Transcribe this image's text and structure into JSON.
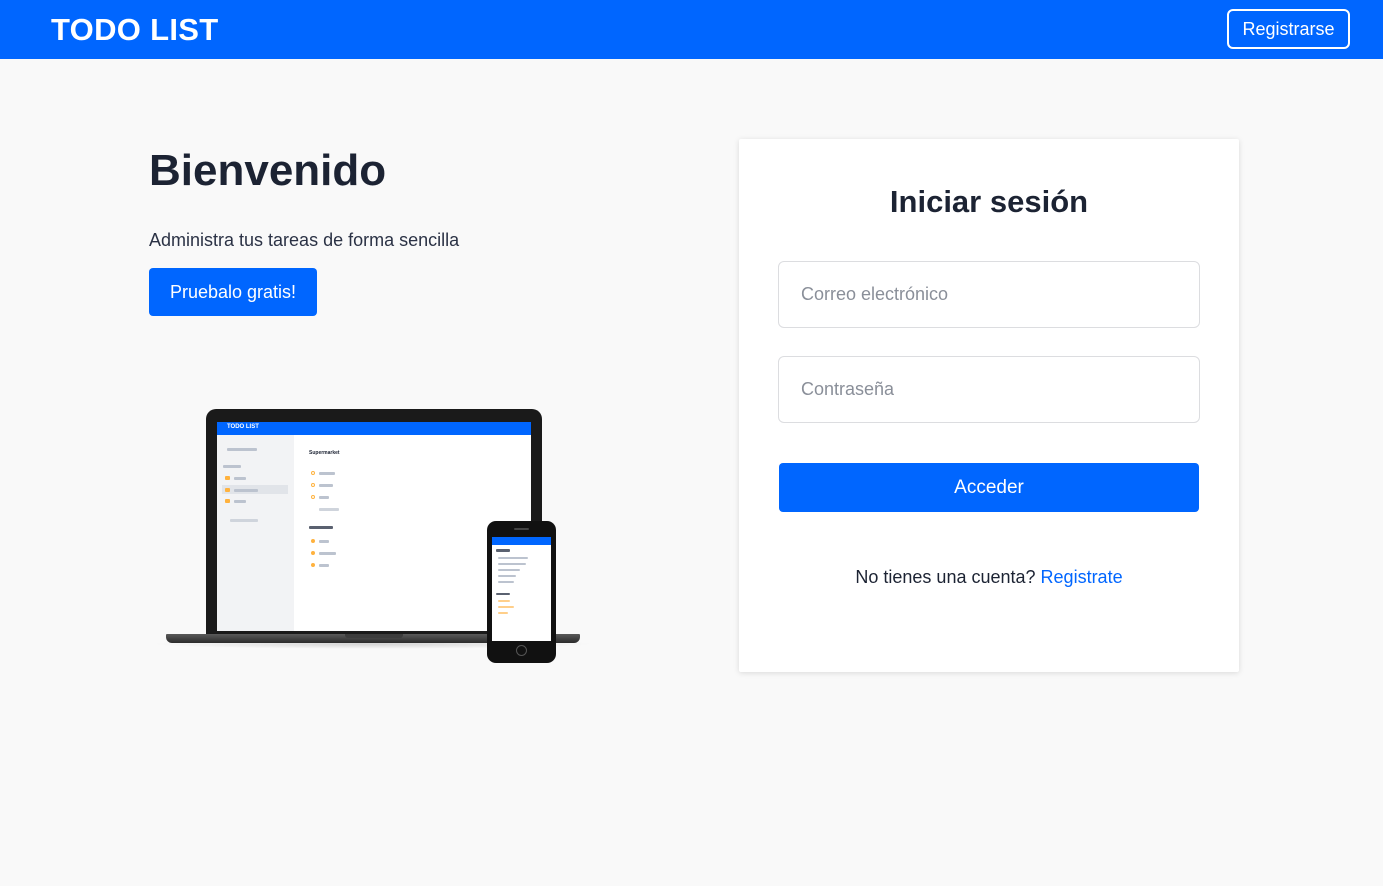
{
  "header": {
    "brand": "TODO LIST",
    "register_button": "Registrarse"
  },
  "hero": {
    "title": "Bienvenido",
    "subtitle": "Administra tus tareas de forma sencilla",
    "cta_button": "Pruebalo gratis!"
  },
  "illustration": {
    "laptop_brand": "TODO LIST",
    "laptop_list_title": "Supermarket"
  },
  "login": {
    "title": "Iniciar sesión",
    "email_placeholder": "Correo electrónico",
    "password_placeholder": "Contraseña",
    "submit_button": "Acceder",
    "signup_prompt": "No tienes una cuenta?",
    "signup_link": "Registrate"
  },
  "colors": {
    "primary": "#0066ff",
    "background": "#f9f9f9",
    "text": "#1c2333"
  }
}
